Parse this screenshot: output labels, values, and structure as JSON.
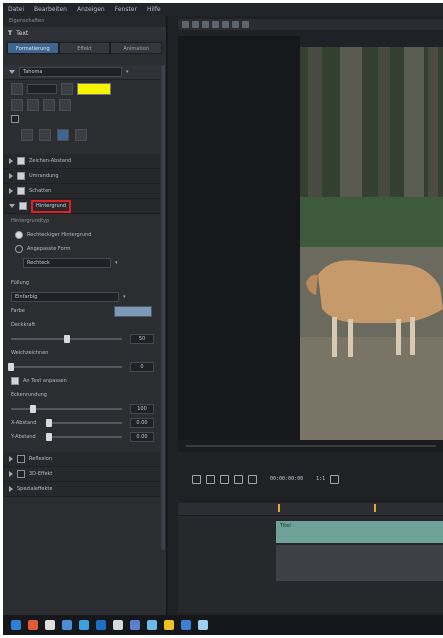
{
  "menubar": {
    "items": [
      "Datei",
      "Bearbeiten",
      "Anzeigen",
      "Fenster",
      "Hilfe"
    ]
  },
  "left_panel": {
    "header": "Eigenschaften",
    "title": "Text",
    "tabs": [
      "Formatierung",
      "Effekt",
      "Animation"
    ],
    "text_block": {
      "font_name": "Tahoma",
      "color_hex": "#f7f400"
    },
    "sections": [
      {
        "label": "Zeichen-Abstand"
      },
      {
        "label": "Umrandung"
      },
      {
        "label": "Schatten"
      },
      {
        "label": "Hintergrund"
      }
    ],
    "background_section": {
      "label": "Hintergrund",
      "sub_label": "Hintergrundtyp",
      "option_1": "Rechteckiger Hintergrund",
      "option_2": "Angepasste Form",
      "shape_select": "Rechteck",
      "fill_label": "Füllung",
      "fill_select": "Einfarbig",
      "color_label": "Farbe",
      "color_hex": "#7e98b8",
      "opacity_label": "Deckkraft",
      "opacity_value": "50",
      "opacity_level": 0.5,
      "blur_label": "Weichzeichnen",
      "blur_value": "0",
      "blur_level": 0.0,
      "fit_label": "An Text anpassen",
      "corner_label": "Eckenrundung",
      "corner_value": "100",
      "corner_level": 0.2,
      "padding_x_label": "X-Abstand",
      "padding_x_value": "0.00",
      "padding_x_level": 0.0,
      "padding_y_label": "Y-Abstand",
      "padding_y_value": "0.00",
      "padding_y_level": 0.0
    },
    "bottom_sections": [
      {
        "label": "Reflexion"
      },
      {
        "label": "3D-Effekt"
      },
      {
        "label": "Spezialeffekte"
      }
    ]
  },
  "player": {
    "timecode": "00:00:00:00",
    "zoom": "1:1"
  },
  "timeline": {
    "clip_label": "Titel"
  },
  "colors": {
    "accent": "#3f6590",
    "highlight_border": "#e02020",
    "timeline_clip": "#6fa39a"
  }
}
